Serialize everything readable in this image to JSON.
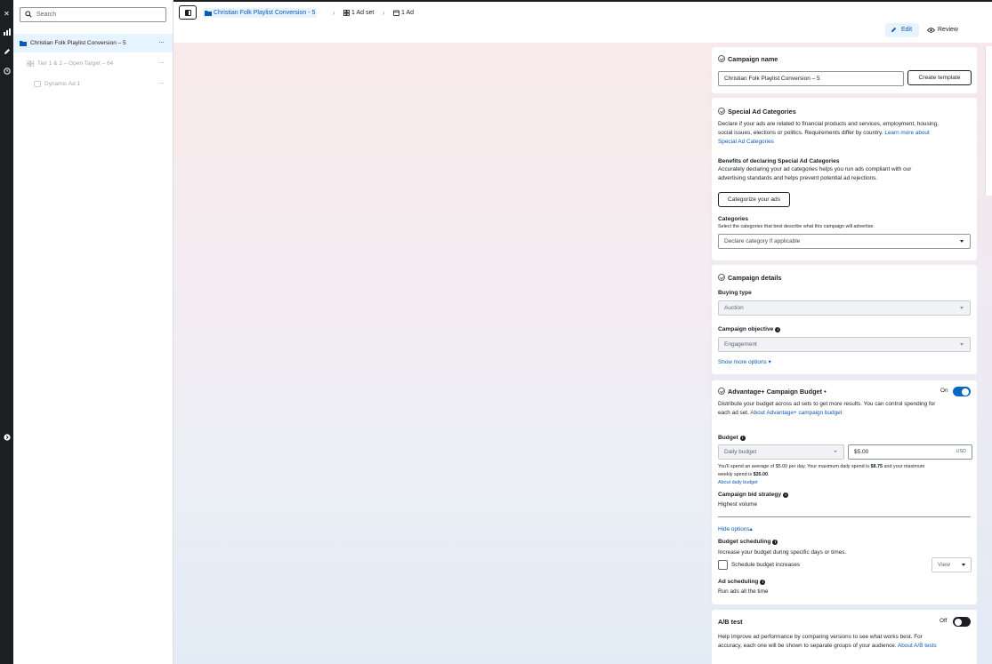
{
  "search": {
    "placeholder": "Search"
  },
  "tree": {
    "campaign": "Christian Folk Playlist Conversion – 5",
    "adset": "Tier 1 & 2 – Open Target – 64",
    "ad": "Dynamic Ad 1",
    "more": "···"
  },
  "breadcrumb": {
    "campaign": "Christian Folk Playlist Conversion - 5",
    "adset": "1 Ad set",
    "ad": "1 Ad"
  },
  "toolbar": {
    "edit": "Edit",
    "review": "Review"
  },
  "campaign_name": {
    "title": "Campaign name",
    "value": "Christian Folk Playlist Conversion – 5",
    "create_template": "Create template"
  },
  "special_ad": {
    "title": "Special Ad Categories",
    "desc_line1": "Declare if your ads are related to financial products and services, employment, housing,",
    "desc_line2a": "social issues, elections or politics. Requirements differ by country. ",
    "link1": "Learn more about",
    "link2": "Special Ad Categories",
    "benefits_title": "Benefits of declaring Special Ad Categories",
    "benefits_line1": "Accurately declaring your ad categories helps you run ads compliant with our",
    "benefits_line2": "advertising standards and helps prevent potential ad rejections.",
    "categorize_button": "Categorize your ads",
    "categories_label": "Categories",
    "categories_hint": "Select the categories that best describe what this campaign will advertise.",
    "categories_placeholder": "Declare category if applicable"
  },
  "campaign_details": {
    "title": "Campaign details",
    "buying_type_label": "Buying type",
    "buying_type_value": "Auction",
    "objective_label": "Campaign objective",
    "objective_value": "Engagement",
    "show_more": "Show more options"
  },
  "budget": {
    "title": "Advantage+ Campaign Budget",
    "bullet": "•",
    "toggle_label": "On",
    "desc_line1": "Distribute your budget across ad sets to get more results. You can control spending for",
    "desc_line2a": "each ad set. ",
    "desc_link": "About Advantage+ campaign budget",
    "budget_label": "Budget",
    "budget_type": "Daily budget",
    "budget_value": "$5.00",
    "currency": "USD",
    "spend_line1a": "You'll spend an average of $5.00 per day. Your maximum daily spend is ",
    "spend_max_daily": "$8.75",
    "spend_line1b": " and your maximum",
    "spend_line2a": "weekly spend is ",
    "spend_max_weekly": "$35.00",
    "spend_line2b": ".",
    "about_daily": "About daily budget",
    "bid_label": "Campaign bid strategy",
    "bid_value": "Highest volume",
    "hide_options": "Hide options",
    "scheduling_label": "Budget scheduling",
    "scheduling_desc": "Increase your budget during specific days or times.",
    "schedule_checkbox": "Schedule budget increases",
    "view_button": "View",
    "ad_scheduling_label": "Ad scheduling",
    "ad_scheduling_value": "Run ads all the time"
  },
  "ab_test": {
    "title": "A/B test",
    "toggle_label": "Off",
    "desc_line1": "Help improve ad performance by comparing versions to see what works best. For",
    "desc_line2a": "accuracy, each one will be shown to separate groups of your audience. ",
    "link": "About A/B tests"
  },
  "colors": {
    "accent": "#0a66c2",
    "link": "#0a5ab8",
    "selected_bg": "#e7f3ff",
    "rail": "#1c1e21"
  }
}
